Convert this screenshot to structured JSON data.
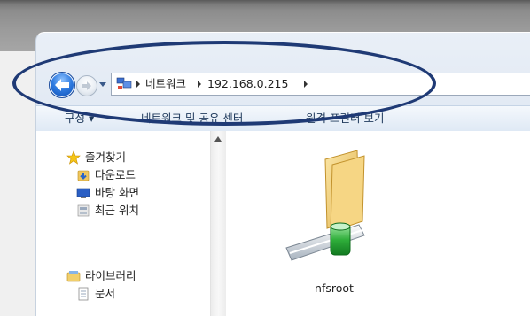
{
  "address_bar": {
    "segments": [
      "네트워크",
      "192.168.0.215"
    ]
  },
  "toolbar": {
    "organize_label": "구성 ▾",
    "network_center_label": "네트워크 및 공유 센터",
    "remote_printer_label": "원격 프린터 보기"
  },
  "sidebar": {
    "favorites_label": "즐겨찾기",
    "favorites_items": [
      "다운로드",
      "바탕 화면",
      "최근 위치"
    ],
    "libraries_label": "라이브러리",
    "libraries_items": [
      "문서"
    ]
  },
  "content": {
    "items": [
      {
        "label": "nfsroot"
      }
    ]
  },
  "colors": {
    "accent_blue": "#2f7be0",
    "highlight_ring": "#1f3a75",
    "folder_yellow": "#f2d27a",
    "share_green": "#2fae3a"
  }
}
